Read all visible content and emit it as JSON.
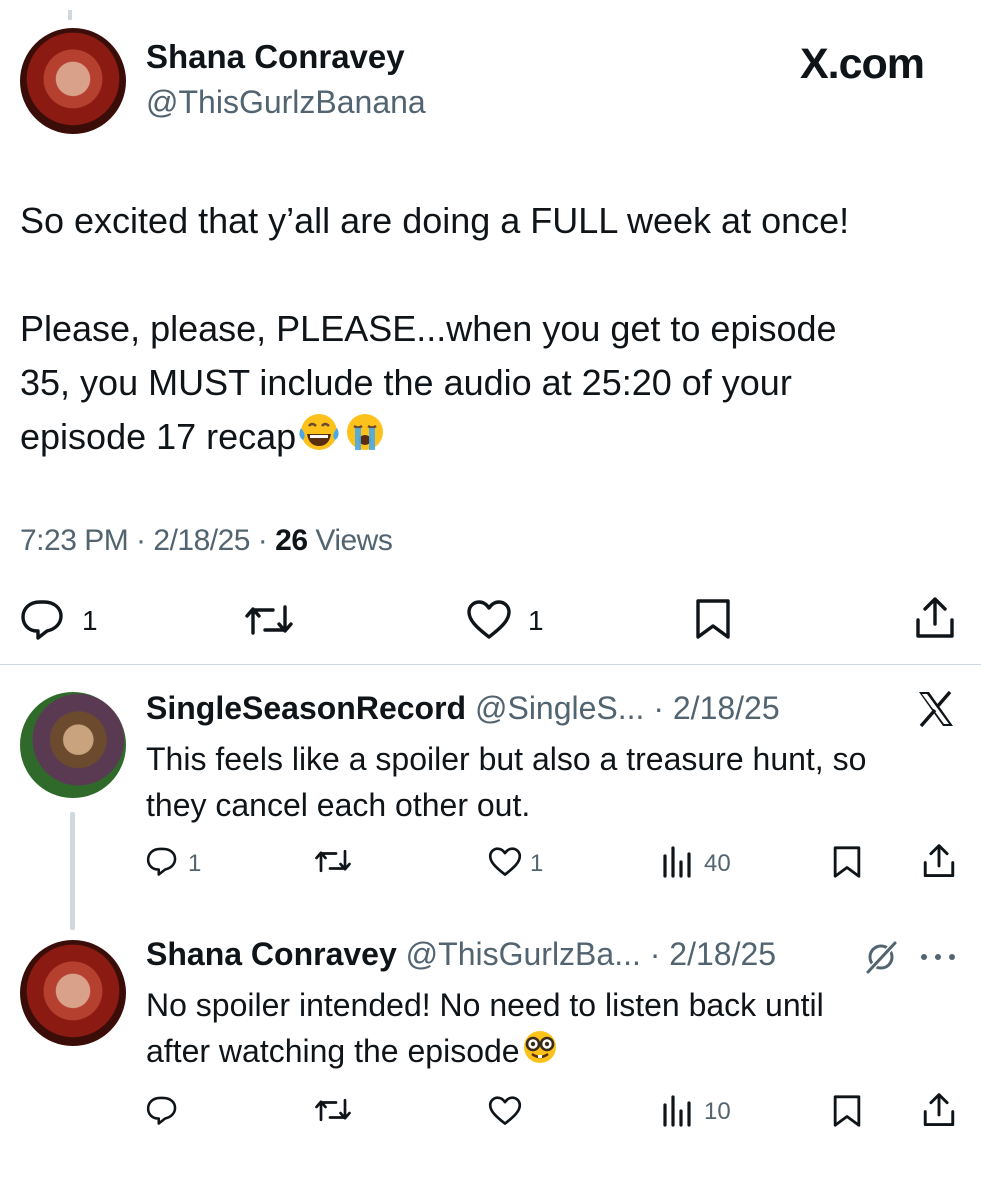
{
  "brand": {
    "label": "X.com"
  },
  "main_post": {
    "name": "Shana Conravey",
    "handle": "@ThisGurlzBanana",
    "line1": "So excited that y’all are doing a FULL week at once!",
    "line2": "Please, please, PLEASE...when you get to episode",
    "line3": "35, you MUST include the audio at 25:20 of your",
    "line4": "episode 17 recap",
    "meta_time": "7:23 PM · 2/18/25 · ",
    "meta_views_count": "26",
    "meta_views_label": " Views",
    "reply_count": "1",
    "like_count": "1"
  },
  "reply1": {
    "name": "SingleSeasonRecord",
    "handle_date": "@SingleS... · 2/18/25",
    "text1": "This feels like a spoiler but also a treasure hunt, so",
    "text2": "they cancel each other out.",
    "reply_count": "1",
    "like_count": "1",
    "views_count": "40"
  },
  "reply2": {
    "name": "Shana Conravey",
    "handle_date": "@ThisGurlzBa... · 2/18/25",
    "text1": "No spoiler intended! No need to listen back until",
    "text2": "after watching the episode",
    "views_count": "10"
  },
  "colors": {
    "text": "#0f1419",
    "muted": "#536471",
    "divider": "#cfd9de"
  }
}
